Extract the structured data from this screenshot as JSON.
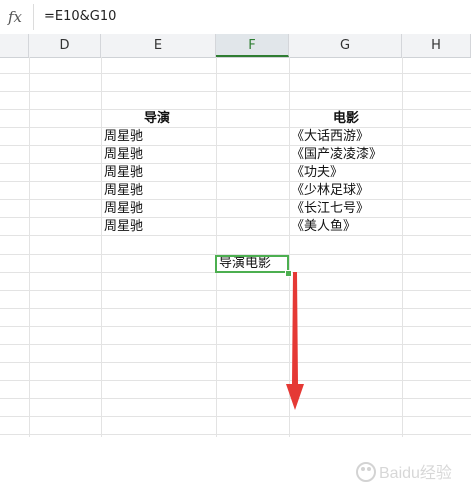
{
  "formula_bar": {
    "fx_label": "fx",
    "formula": "=E10&G10"
  },
  "columns": [
    {
      "id": "D",
      "label": "D"
    },
    {
      "id": "E",
      "label": "E"
    },
    {
      "id": "F",
      "label": "F"
    },
    {
      "id": "G",
      "label": "G"
    },
    {
      "id": "H",
      "label": "H"
    }
  ],
  "selected_column": "F",
  "table": {
    "director_header": "导演",
    "movie_header": "电影",
    "rows": [
      {
        "director": "周星驰",
        "movie": "《大话西游》"
      },
      {
        "director": "周星驰",
        "movie": "《国产凌凌漆》"
      },
      {
        "director": "周星驰",
        "movie": "《功夫》"
      },
      {
        "director": "周星驰",
        "movie": "《少林足球》"
      },
      {
        "director": "周星驰",
        "movie": "《长江七号》"
      },
      {
        "director": "周星驰",
        "movie": "《美人鱼》"
      }
    ]
  },
  "active_cell": {
    "value": "导演电影"
  },
  "colors": {
    "selection": "#4caf50",
    "arrow": "#e53935"
  },
  "watermark_text": "Baidu经验"
}
